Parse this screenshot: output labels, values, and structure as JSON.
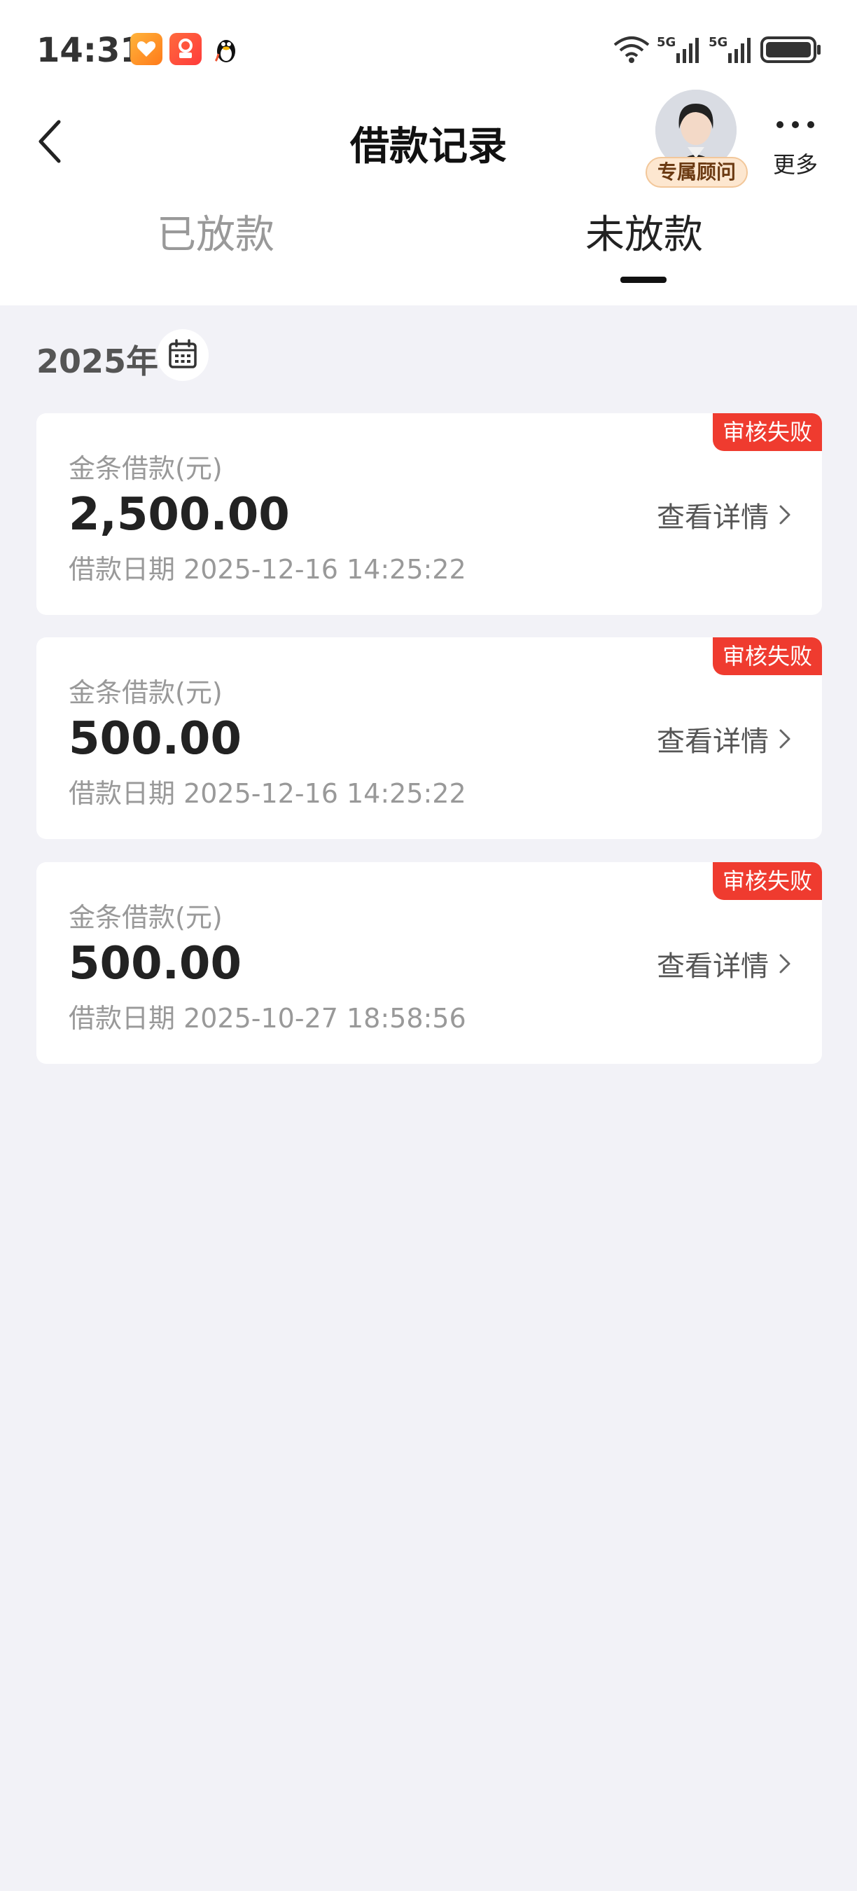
{
  "status_bar": {
    "time": "14:31"
  },
  "nav": {
    "title": "借款记录",
    "advisor_label": "专属顾问",
    "more_label": "更多"
  },
  "tabs": [
    {
      "label": "已放款"
    },
    {
      "label": "未放款"
    }
  ],
  "filter": {
    "year": "2025年"
  },
  "records": [
    {
      "label": "金条借款(元)",
      "amount": "2,500.00",
      "date": "借款日期 2025-12-16 14:25:22",
      "status": "审核失败",
      "link": "查看详情"
    },
    {
      "label": "金条借款(元)",
      "amount": "500.00",
      "date": "借款日期 2025-12-16 14:25:22",
      "status": "审核失败",
      "link": "查看详情"
    },
    {
      "label": "金条借款(元)",
      "amount": "500.00",
      "date": "借款日期 2025-10-27 18:58:56",
      "status": "审核失败",
      "link": "查看详情"
    }
  ],
  "icons": {
    "back": "chevron-left-icon",
    "more": "more-dots-icon",
    "calendar": "calendar-icon",
    "detail": "chevron-right-icon"
  },
  "colors": {
    "badge_red": "#ef3b2f",
    "page_bg": "#f2f2f7",
    "active_tab": "#111111"
  }
}
